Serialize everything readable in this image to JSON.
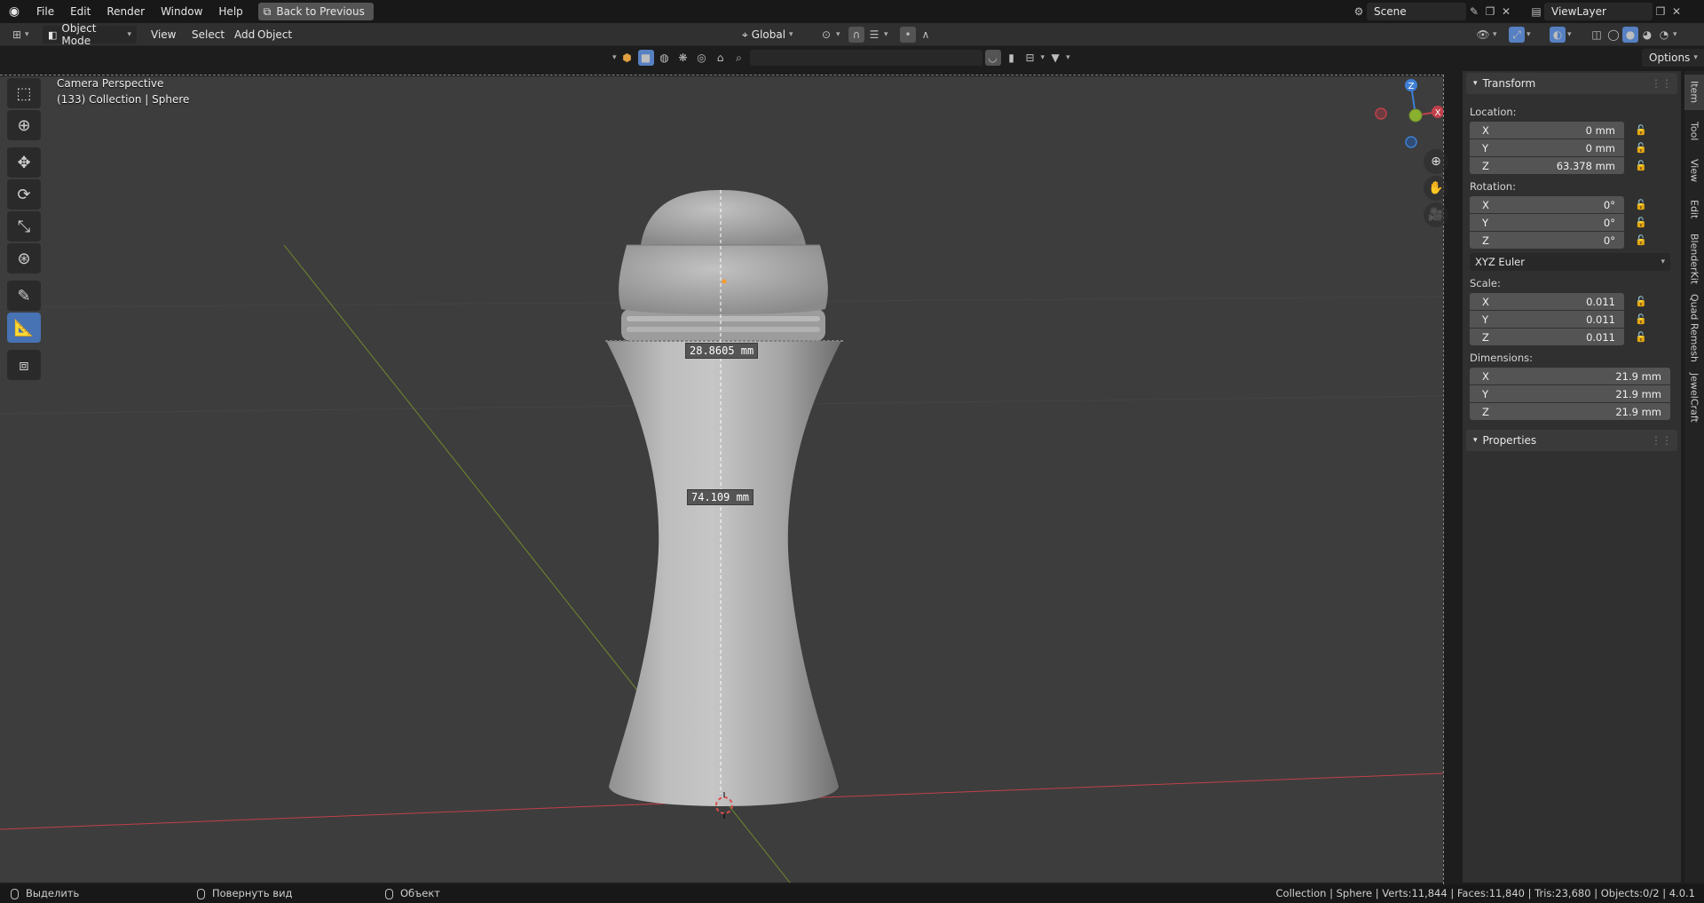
{
  "menubar": {
    "items": [
      "File",
      "Edit",
      "Render",
      "Window",
      "Help"
    ],
    "back_button": "Back to Previous",
    "scene": "Scene",
    "view_layer": "ViewLayer"
  },
  "header": {
    "mode": "Object Mode",
    "menus": [
      "View",
      "Select",
      "Add",
      "Object"
    ],
    "transform_orientation": "Global",
    "options_label": "Options",
    "search_placeholder": ""
  },
  "viewport": {
    "camera_label": "Camera Perspective",
    "collection_label": "(133) Collection | Sphere",
    "measure_width": "28.8605 mm",
    "measure_height": "74.109 mm",
    "gizmo": {
      "z": "Z",
      "x": "X",
      "y": "Y"
    },
    "colors": {
      "background": "#3d3d3d",
      "object": "#b4b4b4",
      "x_axis": "#c0404a",
      "y_axis": "#6f8a2e",
      "active_tool": "#4772b3"
    }
  },
  "npanel": {
    "transform_title": "Transform",
    "location_label": "Location:",
    "location": [
      {
        "axis": "X",
        "value": "0 mm"
      },
      {
        "axis": "Y",
        "value": "0 mm"
      },
      {
        "axis": "Z",
        "value": "63.378 mm"
      }
    ],
    "rotation_label": "Rotation:",
    "rotation": [
      {
        "axis": "X",
        "value": "0°"
      },
      {
        "axis": "Y",
        "value": "0°"
      },
      {
        "axis": "Z",
        "value": "0°"
      }
    ],
    "rotation_mode": "XYZ Euler",
    "scale_label": "Scale:",
    "scale": [
      {
        "axis": "X",
        "value": "0.011"
      },
      {
        "axis": "Y",
        "value": "0.011"
      },
      {
        "axis": "Z",
        "value": "0.011"
      }
    ],
    "dimensions_label": "Dimensions:",
    "dimensions": [
      {
        "axis": "X",
        "value": "21.9 mm"
      },
      {
        "axis": "Y",
        "value": "21.9 mm"
      },
      {
        "axis": "Z",
        "value": "21.9 mm"
      }
    ],
    "properties_title": "Properties"
  },
  "sidetabs": [
    "Item",
    "Tool",
    "View",
    "Edit",
    "BlenderKit",
    "Quad Remesh",
    "JewelCraft"
  ],
  "statusbar": {
    "left_action": "Выделить",
    "middle_action": "Повернуть вид",
    "right_action": "Объект",
    "stats": "Collection | Sphere | Verts:11,844 | Faces:11,840 | Tris:23,680 | Objects:0/2 | 4.0.1"
  }
}
